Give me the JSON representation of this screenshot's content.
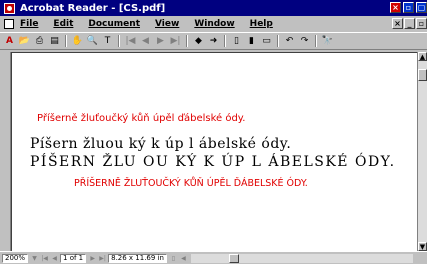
{
  "window": {
    "title": "Acrobat Reader - [CS.pdf]",
    "buttons": [
      "×",
      "▫",
      "▢"
    ]
  },
  "menubar": {
    "items": [
      "File",
      "Edit",
      "Document",
      "View",
      "Window",
      "Help"
    ],
    "mdi_buttons": [
      "×",
      "_",
      "▫"
    ]
  },
  "toolbar": {
    "icons": [
      "acrobat-logo-icon",
      "open-icon",
      "print-icon",
      "page-only-icon",
      "hand-tool-icon",
      "zoom-tool-icon",
      "text-select-icon",
      "first-page-icon",
      "prev-page-icon",
      "next-page-icon",
      "last-page-icon",
      "go-back-icon",
      "go-forward-icon",
      "actual-size-icon",
      "fit-page-icon",
      "fit-width-icon",
      "rotate-left-icon",
      "rotate-right-icon",
      "find-icon"
    ]
  },
  "document": {
    "line1": "Příšerně žluťoučký kůň úpěl ďábelské ódy.",
    "line2": "Píšern  žluou ký k   úp l  ábelské ódy.",
    "line3": "PÍŠERN  ŽLU OU KÝ  K     ÚP L  ÁBELSKÉ ÓDY.",
    "line4": "PŘÍŠERNĚ ŽLUŤOUČKÝ KŮŇ ÚPĚL ĎÁBELSKÉ ÓDY."
  },
  "statusbar": {
    "zoom": "200%",
    "page": "1 of 1",
    "page_size": "8.26 x 11.69 in"
  },
  "colors": {
    "title_bg": "#000080",
    "red_text": "#e00000",
    "chrome": "#c0c0c0"
  }
}
